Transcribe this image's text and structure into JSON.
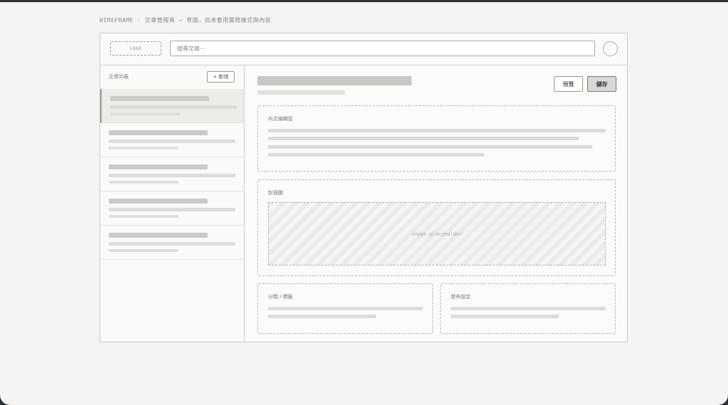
{
  "caption": "WIREFRAME · 文章管理頁 — 草圖，尚未套用實際樣式與內容",
  "topbar": {
    "logo": "LOGO",
    "search_placeholder": "搜尋文章⋯"
  },
  "sidebar": {
    "title": "文章列表",
    "add_label": "+ 新增",
    "item_count": 5,
    "selected_index": 0
  },
  "toolbar": {
    "preview_label": "預覽",
    "save_label": "儲存"
  },
  "sections": {
    "body_label": "內文編輯區",
    "cover_label": "封面圖",
    "image_placeholder": "image placeholder",
    "category_label": "分類 / 標籤",
    "publish_label": "發布設定"
  }
}
